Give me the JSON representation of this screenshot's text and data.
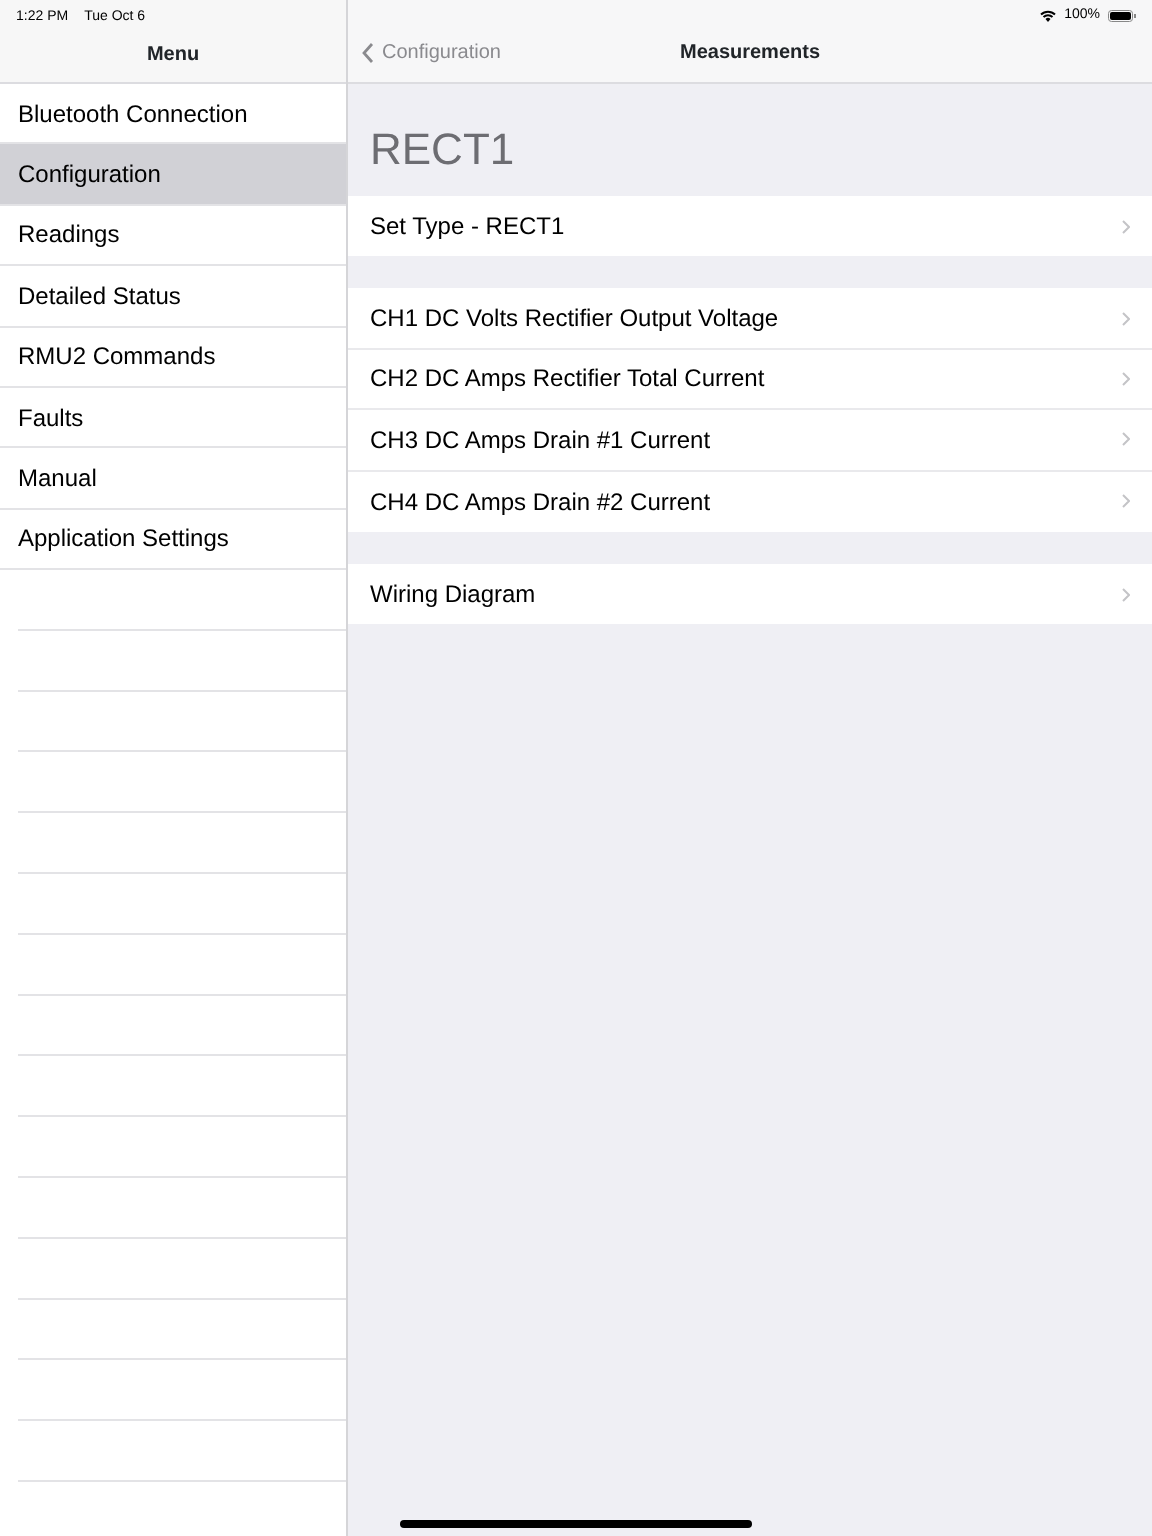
{
  "status_bar": {
    "time": "1:22 PM",
    "date": "Tue Oct 6",
    "battery": "100%"
  },
  "sidebar": {
    "title": "Menu",
    "items": [
      {
        "label": "Bluetooth Connection",
        "selected": false
      },
      {
        "label": "Configuration",
        "selected": true
      },
      {
        "label": "Readings",
        "selected": false
      },
      {
        "label": "Detailed Status",
        "selected": false
      },
      {
        "label": "RMU2 Commands",
        "selected": false
      },
      {
        "label": "Faults",
        "selected": false
      },
      {
        "label": "Manual",
        "selected": false
      },
      {
        "label": "Application Settings",
        "selected": false
      }
    ]
  },
  "nav_bar": {
    "back": "Configuration",
    "title": "Measurements"
  },
  "heading": "RECT1",
  "sections": [
    [
      {
        "label": "Set Type - RECT1"
      }
    ],
    [
      {
        "label": "CH1 DC Volts Rectifier Output Voltage"
      },
      {
        "label": "CH2 DC Amps Rectifier Total Current"
      },
      {
        "label": "CH3 DC Amps Drain #1 Current"
      },
      {
        "label": "CH4 DC Amps Drain #2 Current"
      }
    ],
    [
      {
        "label": "Wiring Diagram"
      }
    ]
  ]
}
